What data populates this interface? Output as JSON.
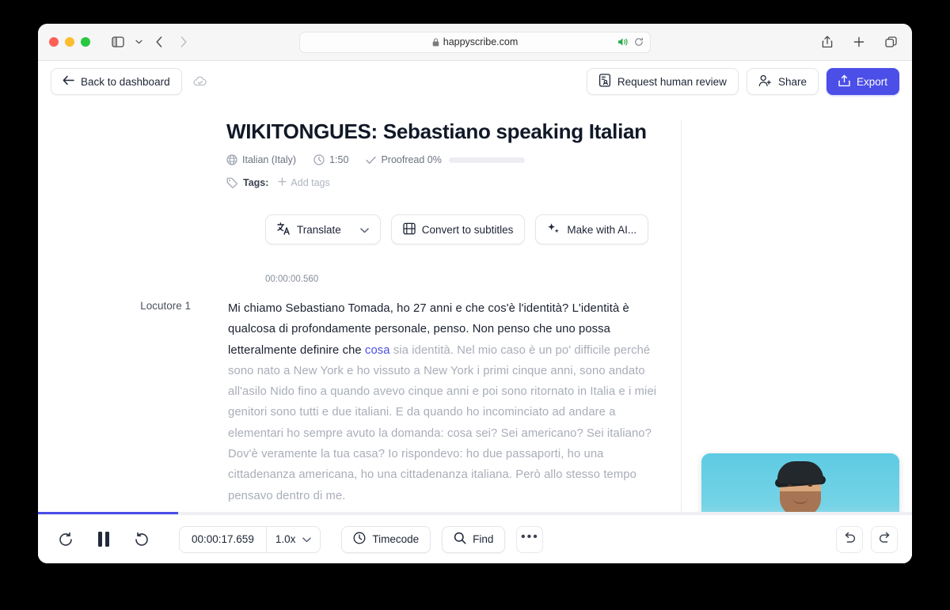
{
  "browser": {
    "url": "happyscribe.com",
    "lock_icon": "lock-icon",
    "audio_icon": "speaker-playing-icon",
    "reload_icon": "reload-icon",
    "sidebar_icon": "sidebar-toggle-icon",
    "back_icon": "nav-back-icon",
    "forward_icon": "nav-forward-icon",
    "share_icon": "share-icon",
    "newtab_icon": "plus-icon",
    "tabs_icon": "tab-overview-icon"
  },
  "appbar": {
    "back_label": "Back to dashboard",
    "back_icon": "arrow-left-icon",
    "saved_icon": "cloud-check-icon",
    "review_label": "Request human review",
    "review_icon": "document-person-icon",
    "share_label": "Share",
    "share_icon": "person-add-icon",
    "export_label": "Export",
    "export_icon": "upload-icon",
    "accent_color": "#4b4ee7"
  },
  "document": {
    "title": "WIKITONGUES: Sebastiano speaking Italian",
    "language": "Italian (Italy)",
    "language_icon": "globe-icon",
    "duration": "1:50",
    "duration_icon": "clock-icon",
    "proofread": "Proofread 0%",
    "proofread_icon": "check-icon",
    "proofread_percent": 0,
    "tags_label": "Tags:",
    "tags_icon": "tag-icon",
    "add_tags_label": "Add tags",
    "add_tags_icon": "plus-icon"
  },
  "actions": {
    "translate_label": "Translate",
    "translate_icon": "translate-icon",
    "translate_chevron": "chevron-down-icon",
    "subtitles_label": "Convert to subtitles",
    "subtitles_icon": "film-icon",
    "ai_label": "Make with AI...",
    "ai_icon": "sparkle-icon"
  },
  "transcript": {
    "timestamp": "00:00:00.560",
    "speaker": "Locutore 1",
    "spoken_text": "Mi chiamo Sebastiano Tomada, ho 27 anni e che cos'è l'identità? L'identità è qualcosa di profondamente personale, penso. Non penso che uno possa letteralmente definire che ",
    "current_word": "cosa",
    "upcoming_text": " sia identità. Nel mio caso è un po' difficile perché sono nato a New York e ho vissuto a New York i primi cinque anni, sono andato all'asilo Nido fino a quando avevo cinque anni e poi sono ritornato in Italia e i miei genitori sono tutti e due italiani. E da quando ho incominciato ad andare a elementari ho sempre avuto la domanda: cosa sei? Sei americano? Sei italiano? Dov'è veramente la tua casa? Io rispondevo: ho due passaporti, ho una cittadenanza americana, ho una cittadenanza italiana. Però allo stesso tempo pensavo dentro di me."
  },
  "player": {
    "rewind_icon": "rewind-10-icon",
    "pause_icon": "pause-icon",
    "forward_icon": "forward-10-icon",
    "timecode_value": "00:00:17.659",
    "speed_value": "1.0x",
    "speed_chevron": "chevron-down-icon",
    "timecode_label": "Timecode",
    "timecode_icon": "clock-icon",
    "find_label": "Find",
    "find_icon": "search-icon",
    "more_label": "•••",
    "more_icon": "ellipsis-icon",
    "undo_icon": "undo-icon",
    "redo_icon": "redo-icon",
    "progress_percent": 16
  },
  "preview": {
    "alt": "video-preview-thumbnail"
  }
}
